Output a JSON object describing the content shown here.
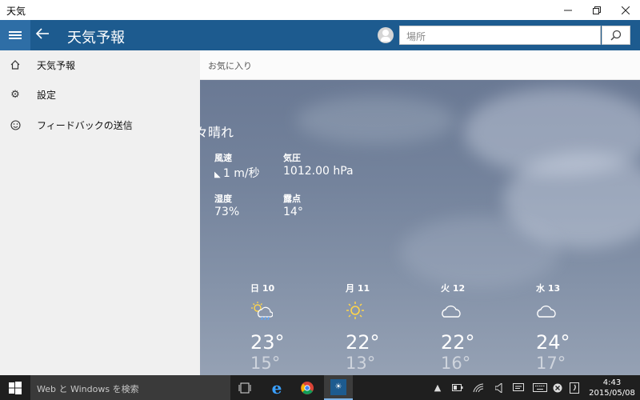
{
  "window": {
    "title": "天気"
  },
  "header": {
    "app_title": "天気予報",
    "search_placeholder": "場所"
  },
  "nav": {
    "items": [
      {
        "label": "天気予報",
        "icon": "home-icon"
      },
      {
        "label": "設定",
        "icon": "gear-icon"
      },
      {
        "label": "フィードバックの送信",
        "icon": "smiley-icon"
      }
    ]
  },
  "favorites": {
    "label": "お気に入り"
  },
  "current": {
    "condition": "々晴れ",
    "wind_label": "風速",
    "wind_value": "1 m/秒",
    "pressure_label": "気圧",
    "pressure_value": "1012.00 hPa",
    "humidity_label": "湿度",
    "humidity_value": "73%",
    "dewpoint_label": "露点",
    "dewpoint_value": "14°"
  },
  "forecast": [
    {
      "day": "日 10",
      "icon": "rain-sun-icon",
      "high": "23°",
      "low": "15°"
    },
    {
      "day": "月 11",
      "icon": "sun-icon",
      "high": "22°",
      "low": "13°"
    },
    {
      "day": "火 12",
      "icon": "cloud-icon",
      "high": "22°",
      "low": "16°"
    },
    {
      "day": "水 13",
      "icon": "cloud-icon",
      "high": "24°",
      "low": "17°"
    }
  ],
  "taskbar": {
    "search_placeholder": "Web と Windows を検索",
    "time": "4:43",
    "date": "2015/05/08"
  },
  "colors": {
    "header": "#1d5b8f",
    "hamburger": "#2e6ea6",
    "sidebar": "#f0f0f0",
    "taskbar": "#1f1f1f"
  }
}
